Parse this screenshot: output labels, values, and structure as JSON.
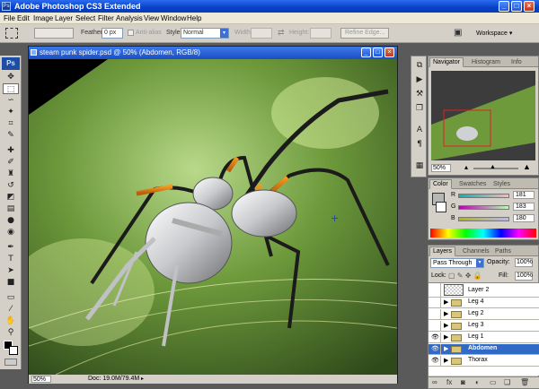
{
  "window": {
    "title": "Adobe Photoshop CS3 Extended",
    "controls": [
      "_",
      "□",
      "×"
    ]
  },
  "menu": [
    "File",
    "Edit",
    "Image",
    "Layer",
    "Select",
    "Filter",
    "Analysis",
    "View",
    "Window",
    "Help"
  ],
  "options_bar": {
    "feather_label": "Feather:",
    "feather_value": "0 px",
    "antialias_label": "Anti-alias",
    "style_label": "Style:",
    "style_value": "Normal",
    "width_label": "Width:",
    "height_label": "Height:",
    "refine_edge": "Refine Edge...",
    "workspace": "Workspace ▾"
  },
  "toolbox": {
    "logo": "Ps",
    "tools": [
      "move-icon",
      "marquee-icon",
      "lasso-icon",
      "magic-wand-icon",
      "crop-icon",
      "slice-icon",
      "healing-icon",
      "brush-icon",
      "clone-stamp-icon",
      "history-brush-icon",
      "eraser-icon",
      "gradient-icon",
      "blur-icon",
      "dodge-icon",
      "pen-icon",
      "type-icon",
      "path-select-icon",
      "shape-icon",
      "notes-icon",
      "eyedropper-icon",
      "hand-icon",
      "zoom-icon"
    ]
  },
  "document": {
    "title": "steam punk spider.psd @ 50% (Abdomen, RGB/8)",
    "zoom": "50%",
    "doc_info": "Doc: 19.0M/79.4M"
  },
  "navigator": {
    "tabs": [
      "Navigator",
      "Histogram",
      "Info"
    ],
    "zoom": "50%"
  },
  "color_panel": {
    "tabs": [
      "Color",
      "Swatches",
      "Styles"
    ],
    "channels": [
      {
        "label": "R",
        "value": "181"
      },
      {
        "label": "G",
        "value": "183"
      },
      {
        "label": "B",
        "value": "180"
      }
    ]
  },
  "layers_panel": {
    "tabs": [
      "Layers",
      "Channels",
      "Paths"
    ],
    "blend_mode": "Pass Through",
    "opacity_label": "Opacity:",
    "opacity": "100%",
    "lock_label": "Lock:",
    "fill_label": "Fill:",
    "fill": "100%",
    "layers": [
      {
        "name": "Layer 2",
        "type": "layer",
        "visible": false,
        "selected": false
      },
      {
        "name": "Leg 4",
        "type": "group",
        "visible": false,
        "selected": false
      },
      {
        "name": "Leg 2",
        "type": "group",
        "visible": false,
        "selected": false
      },
      {
        "name": "Leg 3",
        "type": "group",
        "visible": false,
        "selected": false
      },
      {
        "name": "Leg 1",
        "type": "group",
        "visible": true,
        "selected": false
      },
      {
        "name": "Abdomen",
        "type": "group",
        "visible": true,
        "selected": true
      },
      {
        "name": "Thorax",
        "type": "group",
        "visible": true,
        "selected": false
      }
    ]
  },
  "colors": {
    "titlebar": "#0842c8",
    "selection": "#316ac5"
  }
}
